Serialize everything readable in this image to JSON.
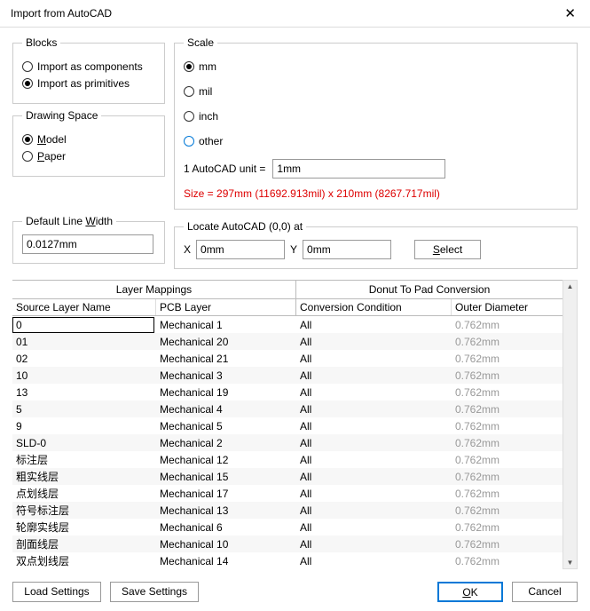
{
  "title": "Import from AutoCAD",
  "blocks": {
    "legend": "Blocks",
    "opt_components": "Import as components",
    "opt_primitives": "Import as primitives",
    "selected": "primitives"
  },
  "drawing_space": {
    "legend": "Drawing Space",
    "opt_model_html": "Model",
    "opt_paper_html": "Paper",
    "selected": "model"
  },
  "default_line_width": {
    "legend": "Default Line Width",
    "value": "0.0127mm"
  },
  "scale": {
    "legend": "Scale",
    "opt_mm": "mm",
    "opt_mil": "mil",
    "opt_inch": "inch",
    "opt_other": "other",
    "selected": "mm",
    "unit_label": "1 AutoCAD unit =",
    "unit_value": "1mm",
    "size_text": "Size = 297mm (11692.913mil) x 210mm (8267.717mil)"
  },
  "locate": {
    "legend": "Locate AutoCAD (0,0) at",
    "x_label": "X",
    "x_value": "0mm",
    "y_label": "Y",
    "y_value": "0mm",
    "select_btn_html": "Select"
  },
  "table": {
    "group_left": "Layer Mappings",
    "group_right": "Donut To Pad Conversion",
    "col_src": "Source Layer Name",
    "col_pcb": "PCB Layer",
    "col_cond": "Conversion Condition",
    "col_outer": "Outer Diameter",
    "rows": [
      {
        "src": "0",
        "pcb": "Mechanical 1",
        "cond": "All",
        "outer": "0.762mm",
        "editing": true
      },
      {
        "src": "01",
        "pcb": "Mechanical 20",
        "cond": "All",
        "outer": "0.762mm"
      },
      {
        "src": "02",
        "pcb": "Mechanical 21",
        "cond": "All",
        "outer": "0.762mm"
      },
      {
        "src": "10",
        "pcb": "Mechanical 3",
        "cond": "All",
        "outer": "0.762mm"
      },
      {
        "src": "13",
        "pcb": "Mechanical 19",
        "cond": "All",
        "outer": "0.762mm"
      },
      {
        "src": "5",
        "pcb": "Mechanical 4",
        "cond": "All",
        "outer": "0.762mm"
      },
      {
        "src": "9",
        "pcb": "Mechanical 5",
        "cond": "All",
        "outer": "0.762mm"
      },
      {
        "src": "SLD-0",
        "pcb": "Mechanical 2",
        "cond": "All",
        "outer": "0.762mm"
      },
      {
        "src": "标注层",
        "pcb": "Mechanical 12",
        "cond": "All",
        "outer": "0.762mm"
      },
      {
        "src": "粗实线层",
        "pcb": "Mechanical 15",
        "cond": "All",
        "outer": "0.762mm"
      },
      {
        "src": "点划线层",
        "pcb": "Mechanical 17",
        "cond": "All",
        "outer": "0.762mm"
      },
      {
        "src": "符号标注层",
        "pcb": "Mechanical 13",
        "cond": "All",
        "outer": "0.762mm"
      },
      {
        "src": "轮廓实线层",
        "pcb": "Mechanical 6",
        "cond": "All",
        "outer": "0.762mm"
      },
      {
        "src": "剖面线层",
        "pcb": "Mechanical 10",
        "cond": "All",
        "outer": "0.762mm"
      },
      {
        "src": "双点划线层",
        "pcb": "Mechanical 14",
        "cond": "All",
        "outer": "0.762mm"
      }
    ]
  },
  "buttons": {
    "load": "Load Settings",
    "save": "Save Settings",
    "ok_html": "OK",
    "cancel": "Cancel"
  }
}
